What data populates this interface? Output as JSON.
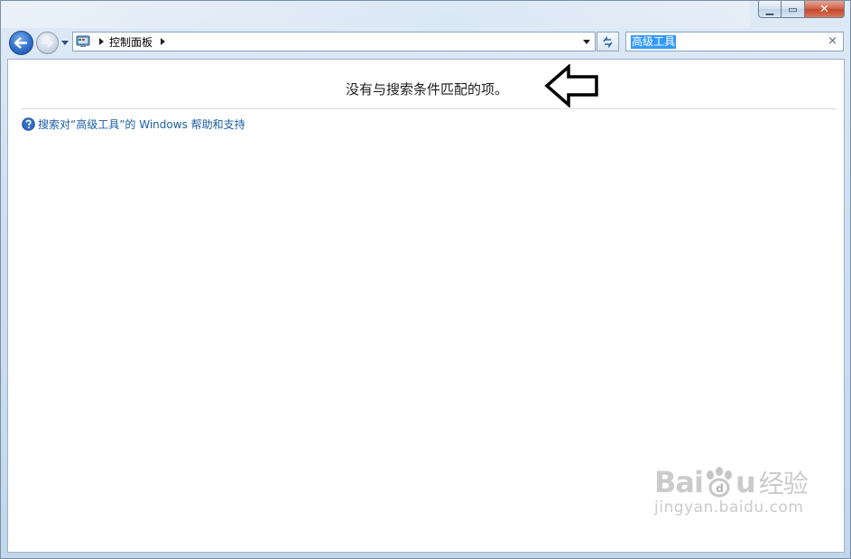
{
  "window": {
    "caption": {
      "minimize": "▁",
      "maximize": "▭",
      "close": "✕"
    }
  },
  "nav": {
    "back_icon": "back-arrow-icon",
    "forward_icon": "forward-arrow-icon",
    "history_icon": "chevron-down-icon"
  },
  "address": {
    "icon": "control-panel-icon",
    "breadcrumbs": [
      "控制面板"
    ]
  },
  "search": {
    "value": "高级工具",
    "clear": "×"
  },
  "content": {
    "no_results": "没有与搜索条件匹配的项。",
    "help_link": "搜索对“高级工具”的 Windows 帮助和支持"
  },
  "watermark": {
    "brand_left": "Bai",
    "brand_right": "u",
    "brand_cn": "经验",
    "url": "jingyan.baidu.com"
  }
}
